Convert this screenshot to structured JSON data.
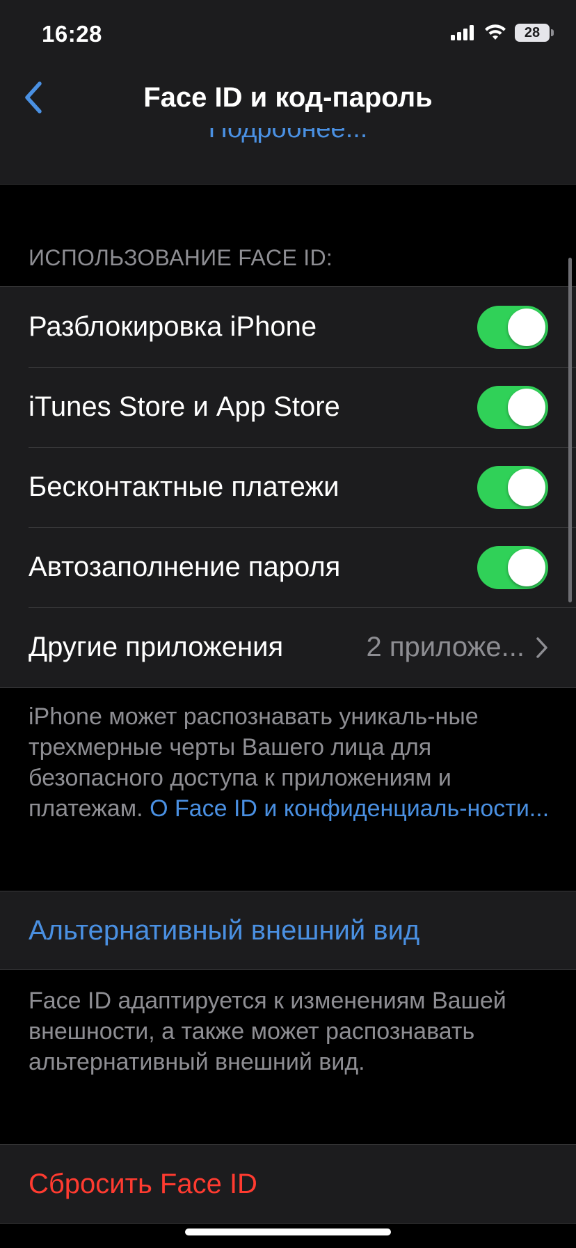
{
  "status_bar": {
    "time": "16:28",
    "battery_level": "28",
    "icons": [
      "signal-icon",
      "wifi-icon",
      "battery-icon"
    ]
  },
  "nav": {
    "back_icon": "chevron-left-icon",
    "title": "Face ID и код-пароль"
  },
  "cutoff_link": "Подробнее...",
  "face_id_section": {
    "header": "ИСПОЛЬЗОВАНИЕ FACE ID:",
    "toggles": [
      {
        "label": "Разблокировка iPhone",
        "on": true
      },
      {
        "label": "iTunes Store и App Store",
        "on": true
      },
      {
        "label": "Бесконтактные платежи",
        "on": true
      },
      {
        "label": "Автозаполнение пароля",
        "on": true
      }
    ],
    "other_apps": {
      "label": "Другие приложения",
      "value": "2 приложе...",
      "icon": "chevron-right-icon"
    },
    "footer_part1": "iPhone может распознавать уникаль-ные трехмерные черты Вашего лица для безопасного доступа к приложениям и платежам. ",
    "footer_link": "О Face ID и конфиденциаль-ности..."
  },
  "alternate_appearance": {
    "label": "Альтернативный внешний вид",
    "footer": "Face ID адаптируется к изменениям Вашей внешности, а также может распознавать альтернативный внешний вид."
  },
  "reset": {
    "label": "Сбросить Face ID"
  },
  "colors": {
    "background": "#000000",
    "cell": "#1c1c1e",
    "separator": "#38383a",
    "secondary_text": "#8e8e93",
    "link_blue": "#4a90e2",
    "toggle_on": "#30d158",
    "destructive_red": "#ff3b30"
  }
}
